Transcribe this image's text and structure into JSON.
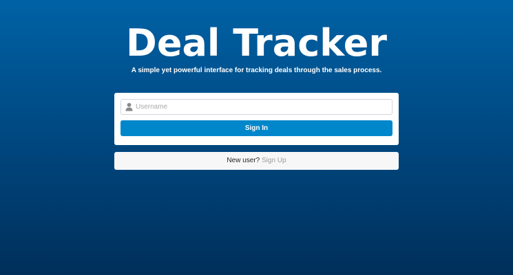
{
  "app": {
    "title": "Deal Tracker",
    "subtitle": "A simple yet powerful interface for tracking deals through the sales process."
  },
  "login_form": {
    "username_placeholder": "Username",
    "username_value": "",
    "username_icon": "user-icon",
    "signin_label": "Sign In"
  },
  "signup": {
    "prompt": "New user?",
    "link_label": "Sign Up"
  },
  "colors": {
    "background_top": "#0062a5",
    "background_bottom": "#002f5a",
    "primary_button": "#0087cb",
    "link": "#9a9a9a"
  }
}
